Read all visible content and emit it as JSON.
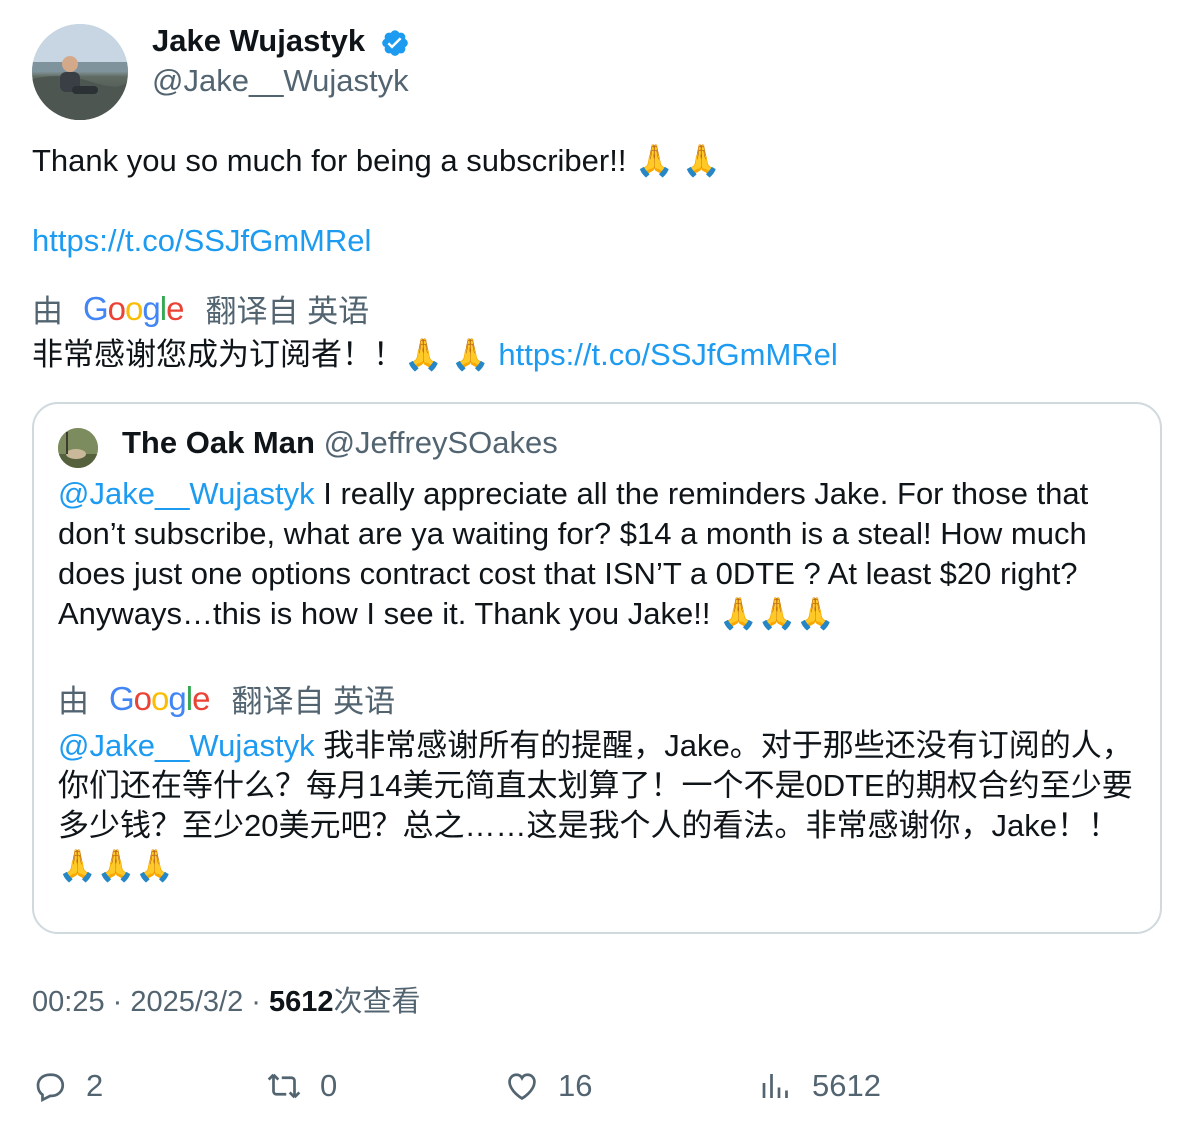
{
  "author": {
    "name": "Jake Wujastyk",
    "handle": "@Jake__Wujastyk"
  },
  "tweet": {
    "text": "Thank you so much for being a subscriber!! 🙏 🙏",
    "link": "https://t.co/SSJfGmMRel"
  },
  "translation": {
    "prefix": "由",
    "google_word": [
      "G",
      "o",
      "o",
      "g",
      "l",
      "e"
    ],
    "suffix": "翻译自 英语",
    "text": "非常感谢您成为订阅者！！🙏 🙏 ",
    "link": "https://t.co/SSJfGmMRel"
  },
  "quoted": {
    "name": "The Oak Man",
    "handle": "@JeffreySOakes",
    "mention": "@Jake__Wujastyk",
    "text": " I really appreciate all the reminders Jake. For those that don’t subscribe, what are ya waiting for? $14 a month is a steal! How much does just one options contract cost that ISN’T a 0DTE ? At least $20 right? Anyways…this is how I see it. Thank you Jake!! 🙏🙏🙏",
    "translation_prefix": "由",
    "translation_suffix": "翻译自 英语",
    "translation_mention": "@Jake__Wujastyk",
    "translation_text": " 我非常感谢所有的提醒，Jake。对于那些还没有订阅的人，你们还在等什么？每月14美元简直太划算了！一个不是0DTE的期权合约至少要多少钱？至少20美元吧？总之……这是我个人的看法。非常感谢你，Jake！！🙏🙏🙏"
  },
  "meta": {
    "time": "00:25",
    "sep": " · ",
    "date": "2025/3/2",
    "views": "5612",
    "views_label": "次查看"
  },
  "actions": {
    "replies": "2",
    "reposts": "0",
    "likes": "16",
    "views": "5612"
  },
  "colors": {
    "link": "#1d9bf0",
    "secondary": "#536471",
    "border": "#cfd9de",
    "verified": "#1d9bf0"
  }
}
